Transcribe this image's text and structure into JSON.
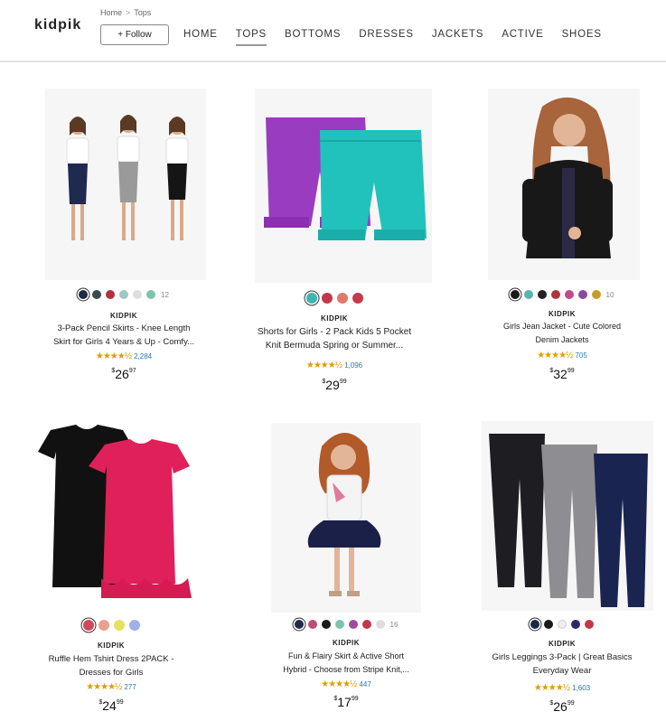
{
  "header": {
    "logo": "kidpik",
    "breadcrumb": [
      "Home",
      "Tops"
    ],
    "breadcrumb_sep": ">",
    "follow_label": "+ Follow",
    "nav": [
      "HOME",
      "TOPS",
      "BOTTOMS",
      "DRESSES",
      "JACKETS",
      "ACTIVE",
      "SHOES"
    ],
    "active_nav": "TOPS"
  },
  "products": [
    {
      "brand": "KIDPIK",
      "title_line1": "3-Pack Pencil Skirts - Knee Length",
      "title_line2": "Skirt for Girls 4 Years & Up - Comfy...",
      "rating": 4.5,
      "reviews": "2,284",
      "price_dollars": "26",
      "price_cents": "97",
      "swatches": [
        "#1f2a44",
        "#3a4a4a",
        "#b0323c",
        "#9fc8c0",
        "#dddddd",
        "#7cc4b0"
      ],
      "more_colors": "12",
      "image": "pencil-skirts"
    },
    {
      "brand": "KIDPIK",
      "title_line1": "Shorts for Girls - 2 Pack Kids 5 Pocket",
      "title_line2": "Knit Bermuda Spring or Summer...",
      "rating": 4.5,
      "reviews": "1,096",
      "price_dollars": "29",
      "price_cents": "99",
      "swatches": [
        "#3fb6b0",
        "#c0394a",
        "#e07a6a",
        "#c63a4a"
      ],
      "more_colors": "",
      "image": "bermuda-shorts"
    },
    {
      "brand": "KIDPIK",
      "title_line1": "Girls Jean Jacket - Cute Colored",
      "title_line2": "Denim Jackets",
      "rating": 4.5,
      "reviews": "705",
      "price_dollars": "32",
      "price_cents": "99",
      "swatches": [
        "#1a1a1a",
        "#5ab4b0",
        "#222222",
        "#b0323c",
        "#c04a8a",
        "#8a4aa0",
        "#c0a02a"
      ],
      "more_colors": "10",
      "image": "jean-jacket"
    },
    {
      "brand": "KIDPIK",
      "title_line1": "Ruffle Hem Tshirt Dress 2PACK -",
      "title_line2": "Dresses for Girls",
      "rating": 4.5,
      "reviews": "277",
      "price_dollars": "24",
      "price_cents": "99",
      "swatches": [
        "#d14a5a",
        "#e8a090",
        "#e8e060",
        "#a0b0e8"
      ],
      "more_colors": "",
      "image": "tshirt-dresses"
    },
    {
      "brand": "KIDPIK",
      "title_line1": "Fun & Flairy Skirt & Active Short",
      "title_line2": "Hybrid - Choose from Stripe Knit,...",
      "rating": 4.5,
      "reviews": "447",
      "price_dollars": "17",
      "price_cents": "99",
      "swatches": [
        "#1f2a50",
        "#c04a7a",
        "#1a1a1a",
        "#7cc4b0",
        "#a04aa0",
        "#c0394a",
        "#dddddd"
      ],
      "more_colors": "16",
      "image": "skort"
    },
    {
      "brand": "KIDPIK",
      "title_line1": "Girls Leggings 3-Pack | Great Basics",
      "title_line2": "Everyday Wear",
      "rating": 4.5,
      "reviews": "1,603",
      "price_dollars": "26",
      "price_cents": "99",
      "swatches": [
        "#1a2a44",
        "#1a1a1a",
        "#eeeeee",
        "#2a2a6a",
        "#c0394a"
      ],
      "more_colors": "",
      "image": "leggings"
    }
  ]
}
